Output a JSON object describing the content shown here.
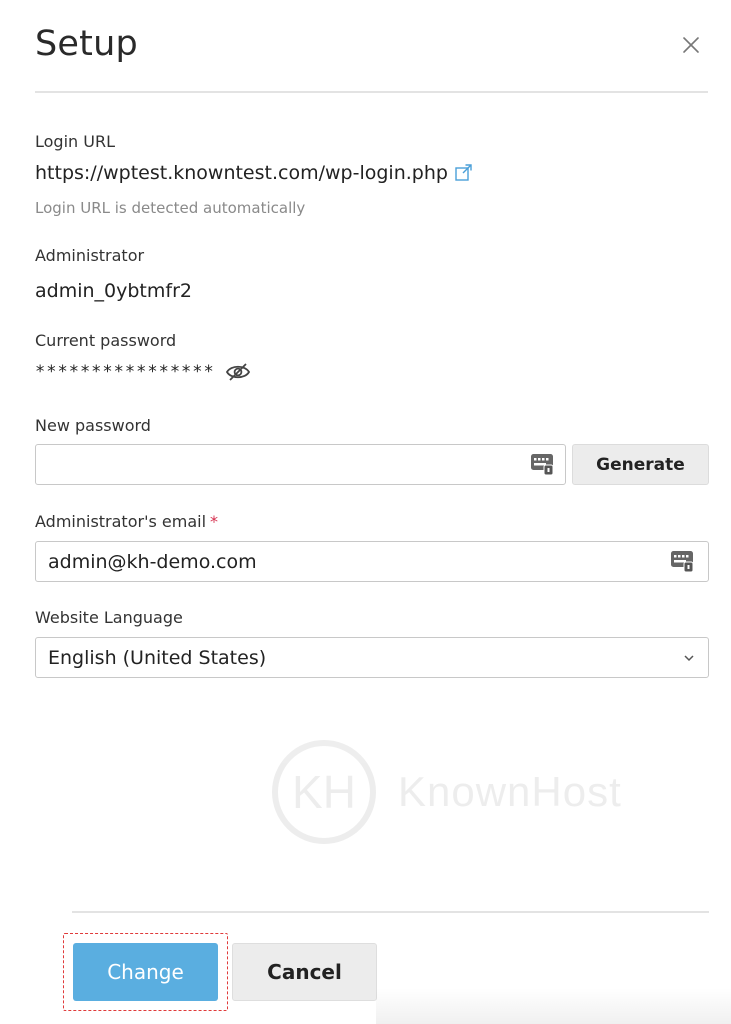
{
  "dialog": {
    "title": "Setup"
  },
  "login_url": {
    "label": "Login URL",
    "value": "https://wptest.knowntest.com/wp-login.php",
    "hint": "Login URL is detected automatically"
  },
  "administrator": {
    "label": "Administrator",
    "value": "admin_0ybtmfr2"
  },
  "current_password": {
    "label": "Current password",
    "masked_value": "****************"
  },
  "new_password": {
    "label": "New password",
    "value": "",
    "placeholder": "",
    "generate_label": "Generate"
  },
  "email": {
    "label": "Administrator's email",
    "required_marker": "*",
    "value": "admin@kh-demo.com"
  },
  "language": {
    "label": "Website Language",
    "selected": "English (United States)"
  },
  "watermark": {
    "letters": "KH",
    "name": "KnownHost"
  },
  "footer": {
    "change_label": "Change",
    "cancel_label": "Cancel"
  },
  "colors": {
    "primary_button": "#5aaee0",
    "link_icon": "#4a9fd8",
    "required": "#d6304f",
    "highlight_border": "#e03a3a"
  },
  "icons": {
    "close": "close-icon",
    "external_link": "external-link-icon",
    "hide_password": "eye-off-icon",
    "keyboard": "keyboard-icon",
    "dropdown": "chevron-down-icon"
  }
}
